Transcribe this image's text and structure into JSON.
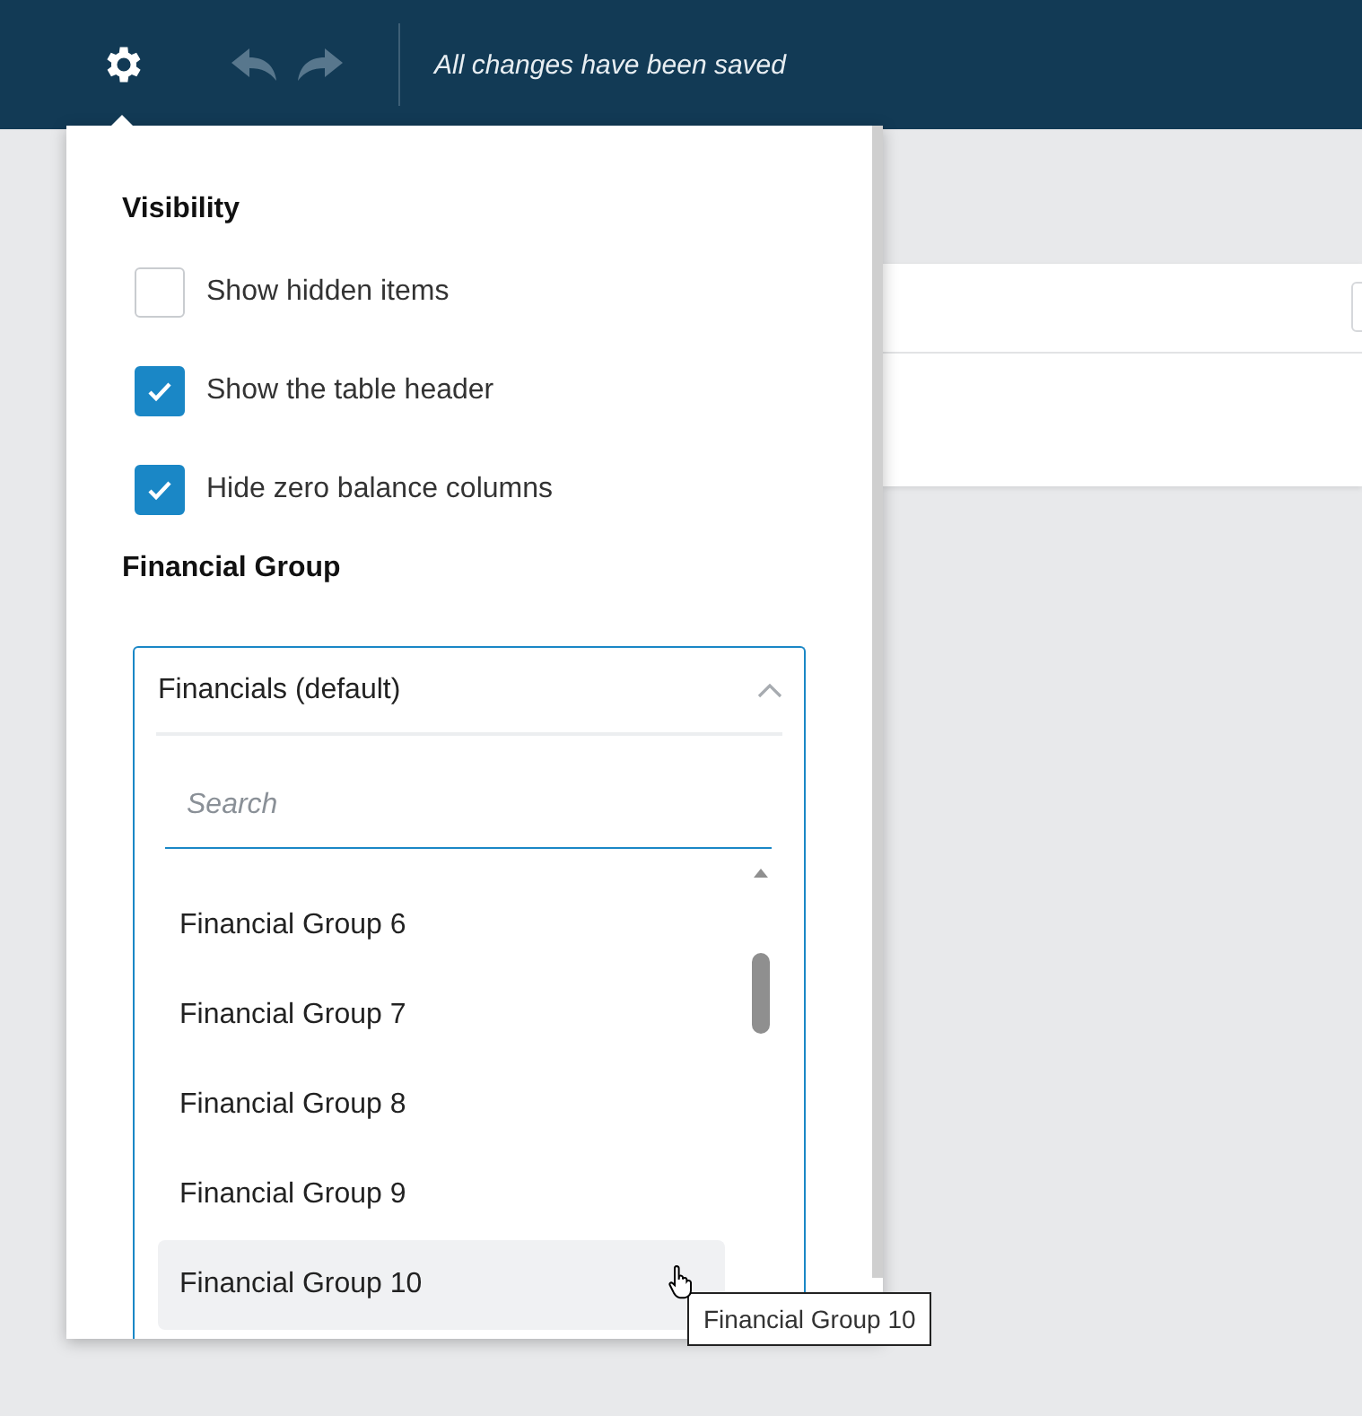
{
  "toolbar": {
    "undo": {
      "disabled": true
    },
    "redo": {
      "disabled": true
    },
    "status": "All changes have been saved"
  },
  "settings_panel": {
    "visibility_heading": "Visibility",
    "checkboxes": [
      {
        "label": "Show hidden items",
        "checked": false
      },
      {
        "label": "Show the table header",
        "checked": true
      },
      {
        "label": "Hide zero balance columns",
        "checked": true
      }
    ],
    "financial_group_heading": "Financial Group",
    "financial_group_select": {
      "value": "Financials (default)",
      "expanded": true,
      "search": {
        "placeholder": "Search"
      },
      "options": [
        {
          "label": "Financial Group 6",
          "highlighted": false
        },
        {
          "label": "Financial Group 7",
          "highlighted": false
        },
        {
          "label": "Financial Group 8",
          "highlighted": false
        },
        {
          "label": "Financial Group 9",
          "highlighted": false
        },
        {
          "label": "Financial Group 10",
          "highlighted": true
        }
      ]
    }
  },
  "tooltip": "Financial Group 10"
}
